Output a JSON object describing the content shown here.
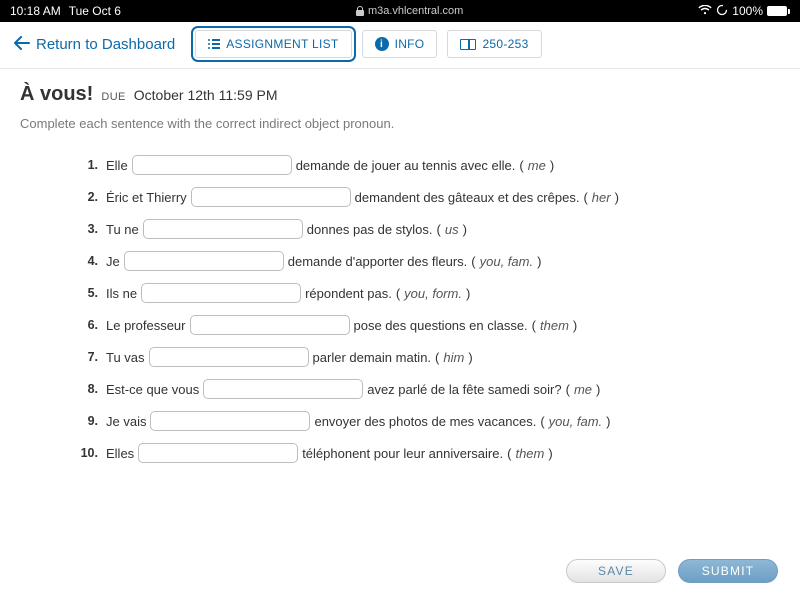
{
  "statusbar": {
    "time": "10:18 AM",
    "date": "Tue Oct 6",
    "battery": "100%",
    "url": "m3a.vhlcentral.com"
  },
  "toolbar": {
    "back": "Return to Dashboard",
    "assignment_list": "ASSIGNMENT LIST",
    "info": "INFO",
    "pages": "250-253"
  },
  "assignment": {
    "title": "À vous!",
    "due_label": "DUE",
    "due_date": "October 12th 11:59 PM",
    "instructions": "Complete each sentence with the correct indirect object pronoun."
  },
  "questions": [
    {
      "num": "1.",
      "pre": "Elle",
      "post": "demande de jouer au tennis avec elle.",
      "hint": "me"
    },
    {
      "num": "2.",
      "pre": "Éric et Thierry",
      "post": "demandent des gâteaux et des crêpes.",
      "hint": "her"
    },
    {
      "num": "3.",
      "pre": "Tu ne",
      "post": "donnes pas de stylos.",
      "hint": "us"
    },
    {
      "num": "4.",
      "pre": "Je",
      "post": "demande d'apporter des fleurs.",
      "hint": "you, fam."
    },
    {
      "num": "5.",
      "pre": "Ils ne",
      "post": "répondent pas.",
      "hint": "you, form."
    },
    {
      "num": "6.",
      "pre": "Le professeur",
      "post": "pose des questions en classe.",
      "hint": "them"
    },
    {
      "num": "7.",
      "pre": "Tu vas",
      "post": "parler demain matin.",
      "hint": "him"
    },
    {
      "num": "8.",
      "pre": "Est-ce que vous",
      "post": "avez parlé de la fête samedi soir?",
      "hint": "me"
    },
    {
      "num": "9.",
      "pre": "Je vais",
      "post": "envoyer des photos de mes vacances.",
      "hint": "you, fam."
    },
    {
      "num": "10.",
      "pre": "Elles",
      "post": "téléphonent pour leur anniversaire.",
      "hint": "them"
    }
  ],
  "buttons": {
    "save": "SAVE",
    "submit": "SUBMIT"
  }
}
